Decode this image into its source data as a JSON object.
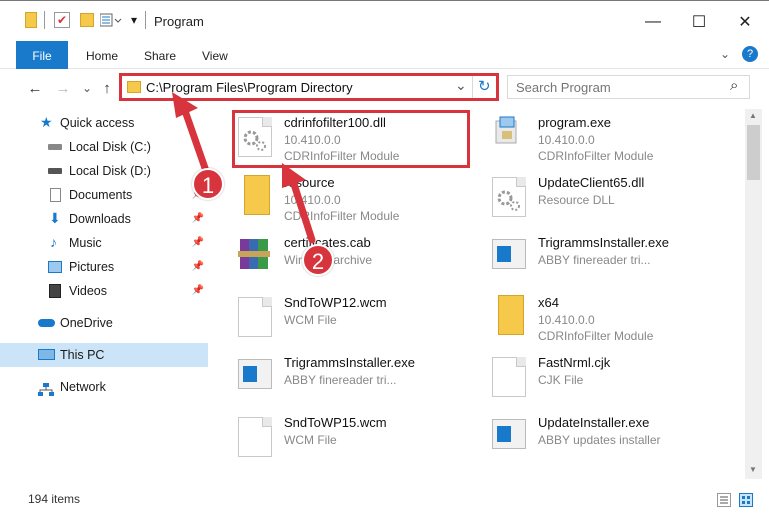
{
  "window": {
    "title": "Program",
    "min_glyph": "—",
    "max_glyph": "☐",
    "close_glyph": "✕",
    "help_glyph": "?"
  },
  "ribbon": {
    "tabs": [
      "File",
      "Home",
      "Share",
      "View"
    ]
  },
  "address": {
    "path": "C:\\Program Files\\Program Directory",
    "search_placeholder": "Search Program",
    "back_glyph": "←",
    "forward_glyph": "→",
    "recent_glyph": "⌄",
    "up_glyph": "↑",
    "dropdown_glyph": "⌄",
    "refresh_glyph": "↻",
    "search_glyph": "⌕"
  },
  "sidebar": {
    "items": [
      {
        "label": "Quick access",
        "icon": "star-icon"
      },
      {
        "label": "Local Disk (C:)",
        "icon": "drive-icon"
      },
      {
        "label": "Local Disk (D:)",
        "icon": "drive-icon"
      },
      {
        "label": "Documents",
        "icon": "documents-icon"
      },
      {
        "label": "Downloads",
        "icon": "download-icon"
      },
      {
        "label": "Music",
        "icon": "music-icon"
      },
      {
        "label": "Pictures",
        "icon": "pictures-icon"
      },
      {
        "label": "Videos",
        "icon": "videos-icon"
      },
      {
        "label": "OneDrive",
        "icon": "cloud-icon"
      },
      {
        "label": "This PC",
        "icon": "computer-icon"
      },
      {
        "label": "Network",
        "icon": "network-icon"
      }
    ]
  },
  "files": [
    {
      "name": "cdrinfofilter100.dll",
      "line2": "10.410.0.0",
      "line3": "CDRInfoFilter Module"
    },
    {
      "name": "program.exe",
      "line2": "10.410.0.0",
      "line3": "CDRInfoFilter Module"
    },
    {
      "name": "resource",
      "line2": "10.410.0.0",
      "line3": "CDRInfoFilter Module"
    },
    {
      "name": "UpdateClient65.dll",
      "line2": "Resource DLL",
      "line3": ""
    },
    {
      "name": "certificates.cab",
      "line2": "WinRAR archive",
      "line3": ""
    },
    {
      "name": "TrigrammsInstaller.exe",
      "line2": "ABBY finereader tri...",
      "line3": ""
    },
    {
      "name": "SndToWP12.wcm",
      "line2": "WCM File",
      "line3": ""
    },
    {
      "name": "x64",
      "line2": "10.410.0.0",
      "line3": "CDRInfoFilter Module"
    },
    {
      "name": "TrigrammsInstaller.exe",
      "line2": "ABBY finereader tri...",
      "line3": ""
    },
    {
      "name": "FastNrml.cjk",
      "line2": "CJK File",
      "line3": ""
    },
    {
      "name": "SndToWP15.wcm",
      "line2": "WCM File",
      "line3": ""
    },
    {
      "name": "UpdateInstaller.exe",
      "line2": "ABBY updates installer",
      "line3": ""
    }
  ],
  "status": {
    "item_count": "194 items"
  },
  "annotations": {
    "badge1": "1",
    "badge2": "2"
  },
  "colors": {
    "accent": "#1979ca",
    "highlight": "#d8343d",
    "selected": "#cce4f7"
  }
}
